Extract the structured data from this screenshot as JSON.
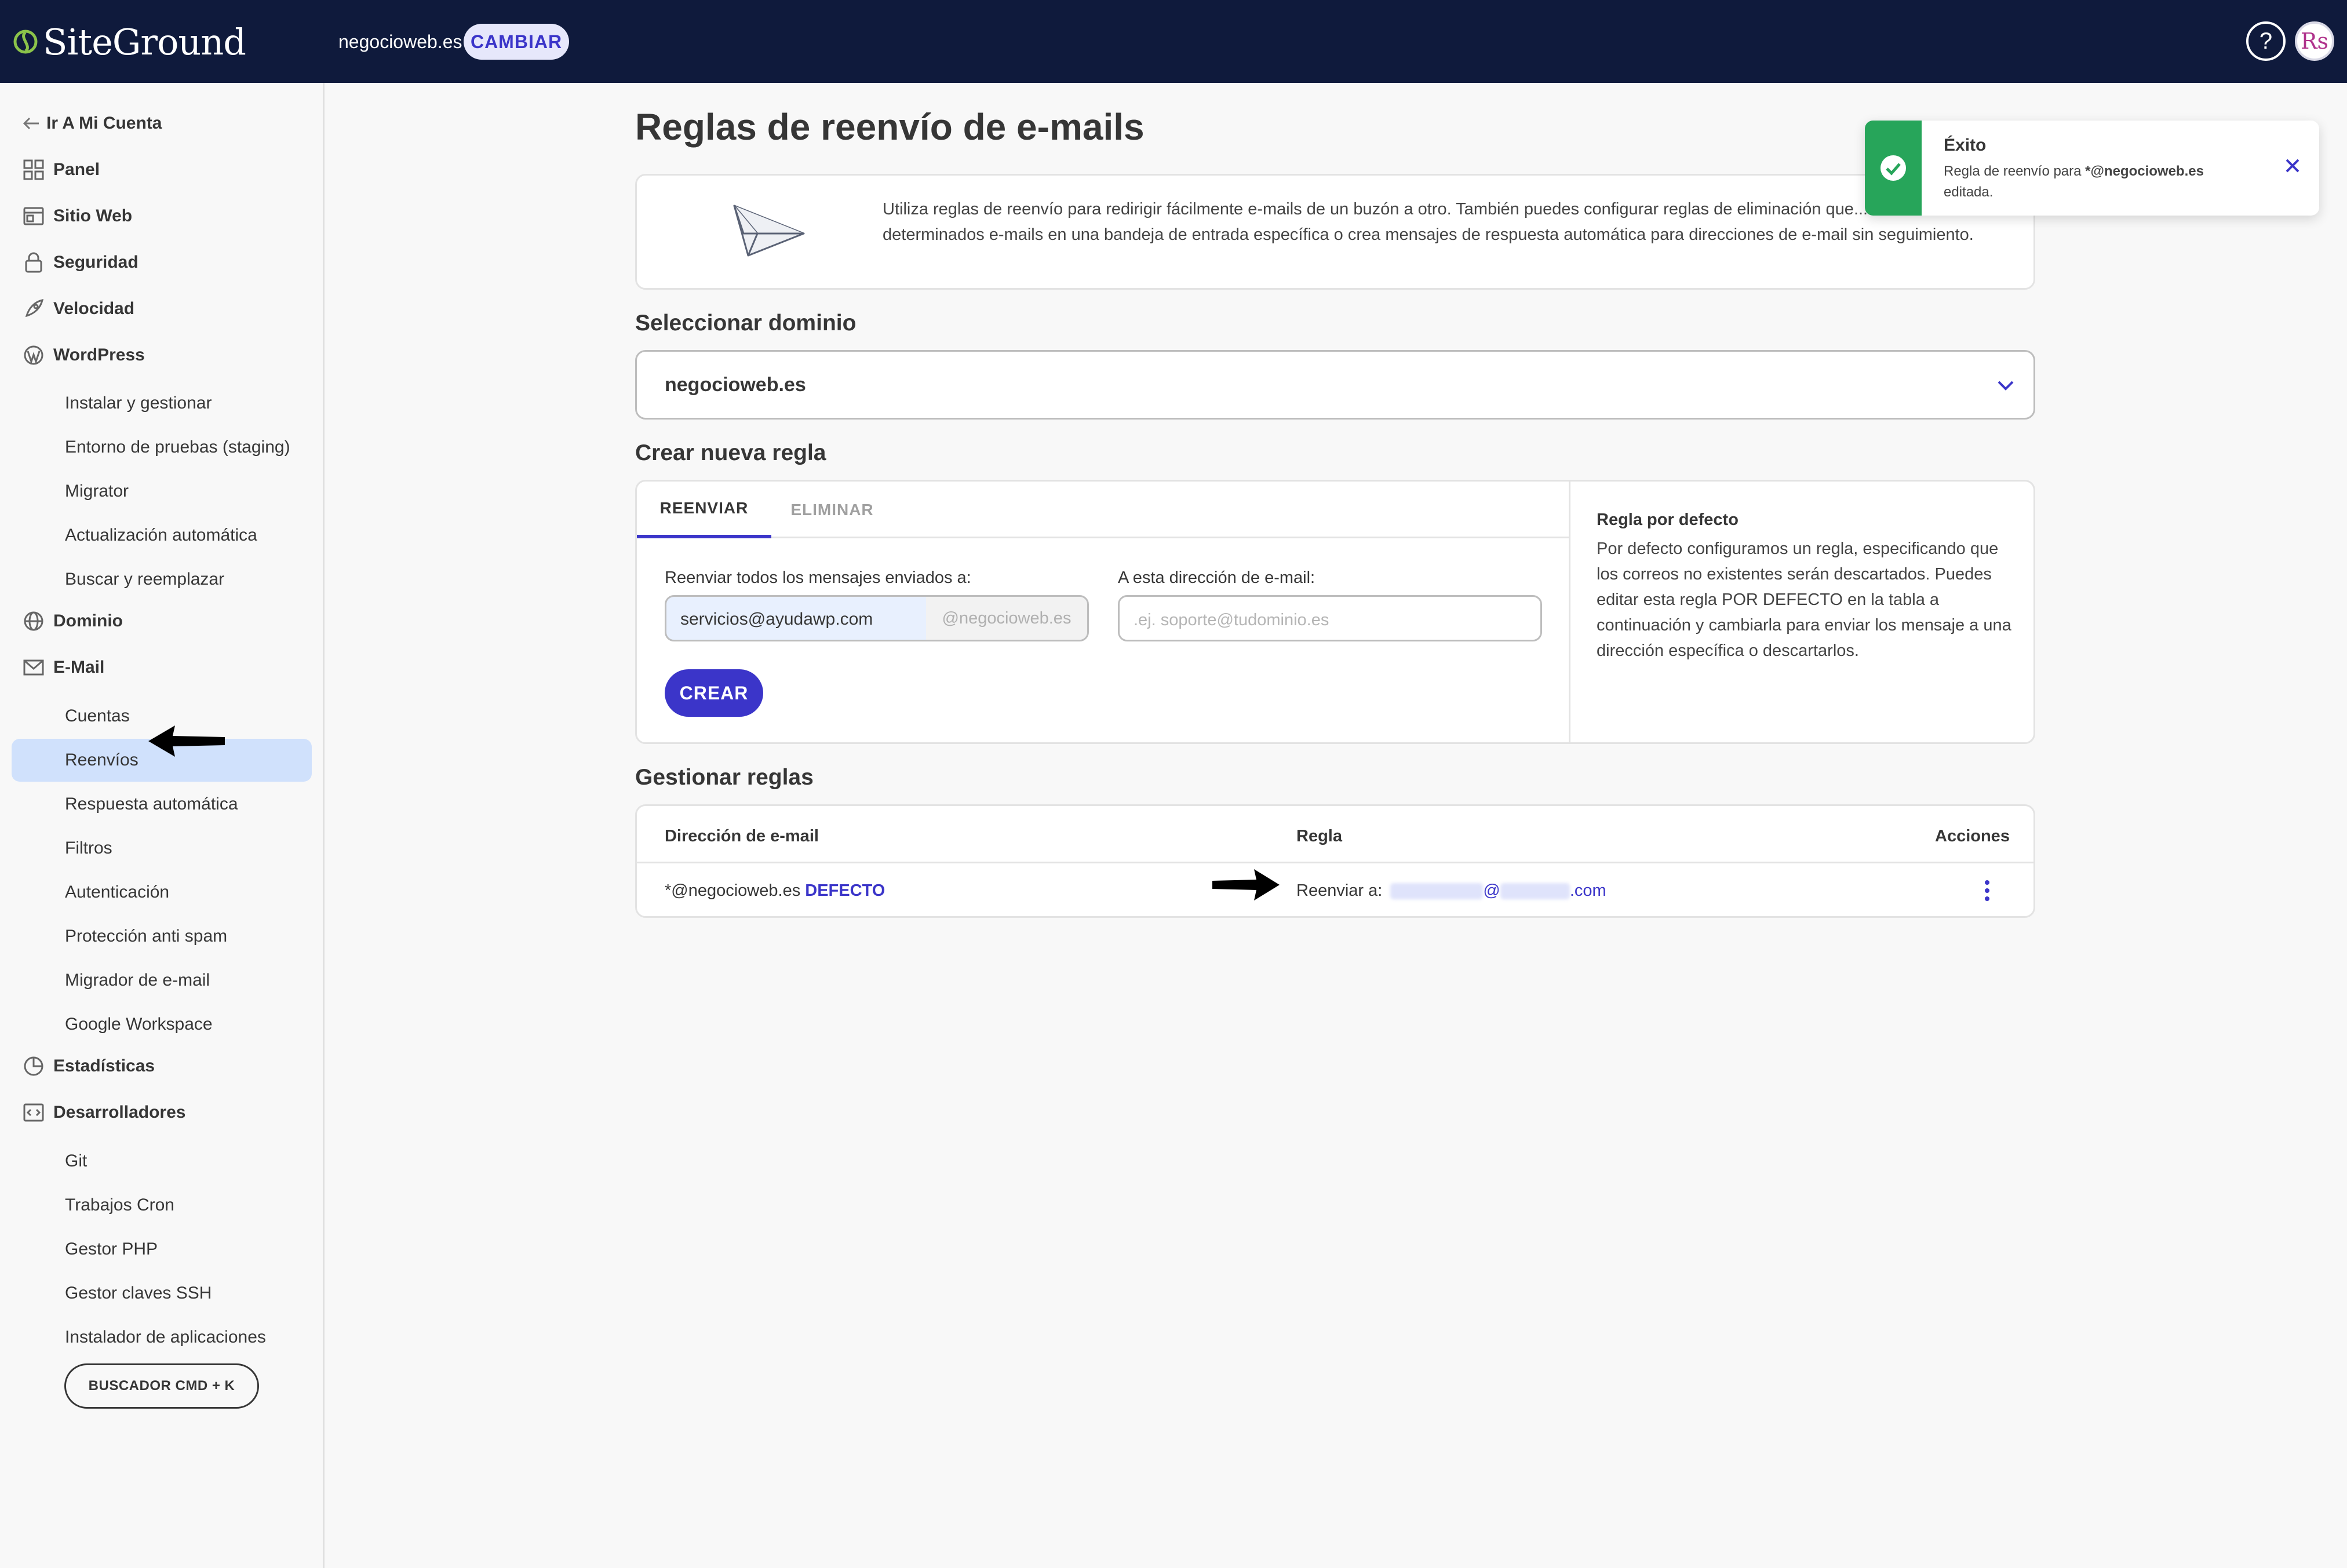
{
  "header": {
    "logo_text": "SiteGround",
    "site_name": "negocioweb.es",
    "change_label": "CAMBIAR",
    "help_label": "?",
    "avatar_initials": "Rs"
  },
  "sidebar": {
    "back_label": "Ir A Mi Cuenta",
    "sections": {
      "panel": "Panel",
      "sitio_web": "Sitio Web",
      "seguridad": "Seguridad",
      "velocidad": "Velocidad",
      "wordpress": "WordPress",
      "dominio": "Dominio",
      "email": "E-Mail",
      "estadisticas": "Estadísticas",
      "desarrolladores": "Desarrolladores"
    },
    "wordpress_items": [
      "Instalar y gestionar",
      "Entorno de pruebas (staging)",
      "Migrator",
      "Actualización automática",
      "Buscar y reemplazar"
    ],
    "email_items": [
      "Cuentas",
      "Reenvíos",
      "Respuesta automática",
      "Filtros",
      "Autenticación",
      "Protección anti spam",
      "Migrador de e-mail",
      "Google Workspace"
    ],
    "dev_items": [
      "Git",
      "Trabajos Cron",
      "Gestor PHP",
      "Gestor claves SSH",
      "Instalador de aplicaciones"
    ],
    "search_label": "BUSCADOR CMD + K"
  },
  "main": {
    "title": "Reglas de reenvío de e-mails",
    "intro": "Utiliza reglas de reenvío para redirigir fácilmente e-mails de un buzón a otro. También puedes configurar reglas de eliminación que... evitar determinados e-mails en una bandeja de entrada específica o crea mensajes de respuesta automática para direcciones de e-mail sin seguimiento.",
    "select_domain_title": "Seleccionar dominio",
    "selected_domain": "negocioweb.es",
    "create_rule_title": "Crear nueva regla",
    "tabs": [
      "REENVIAR",
      "ELIMINAR"
    ],
    "forward_label": "Reenviar todos los mensajes enviados a:",
    "forward_value": "servicios@ayudawp.com",
    "forward_suffix": "@negocioweb.es",
    "to_label": "A esta dirección de e-mail:",
    "to_placeholder": ".ej. soporte@tudominio.es",
    "create_button": "CREAR",
    "default_rule_title": "Regla por defecto",
    "default_rule_text": "Por defecto configuramos un regla, especificando que los correos no existentes serán descartados. Puedes editar esta regla POR DEFECTO en la tabla a continuación y cambiarla para enviar los mensaje a una dirección específica o descartarlos.",
    "manage_title": "Gestionar reglas",
    "table": {
      "headers": [
        "Dirección de e-mail",
        "Regla",
        "Acciones"
      ],
      "rows": [
        {
          "address": "*@negocioweb.es",
          "badge": "DEFECTO",
          "rule_prefix": "Reenviar a:",
          "rule_at": "@",
          "rule_tld": ".com"
        }
      ]
    }
  },
  "toast": {
    "title": "Éxito",
    "body_prefix": "Regla de reenvío para ",
    "body_bold": "*@negocioweb.es",
    "body_suffix": "editada."
  },
  "colors": {
    "topbar": "#0f1a3c",
    "accent": "#3b35c9",
    "success": "#27a55a",
    "active_nav": "#d0e1fc"
  }
}
